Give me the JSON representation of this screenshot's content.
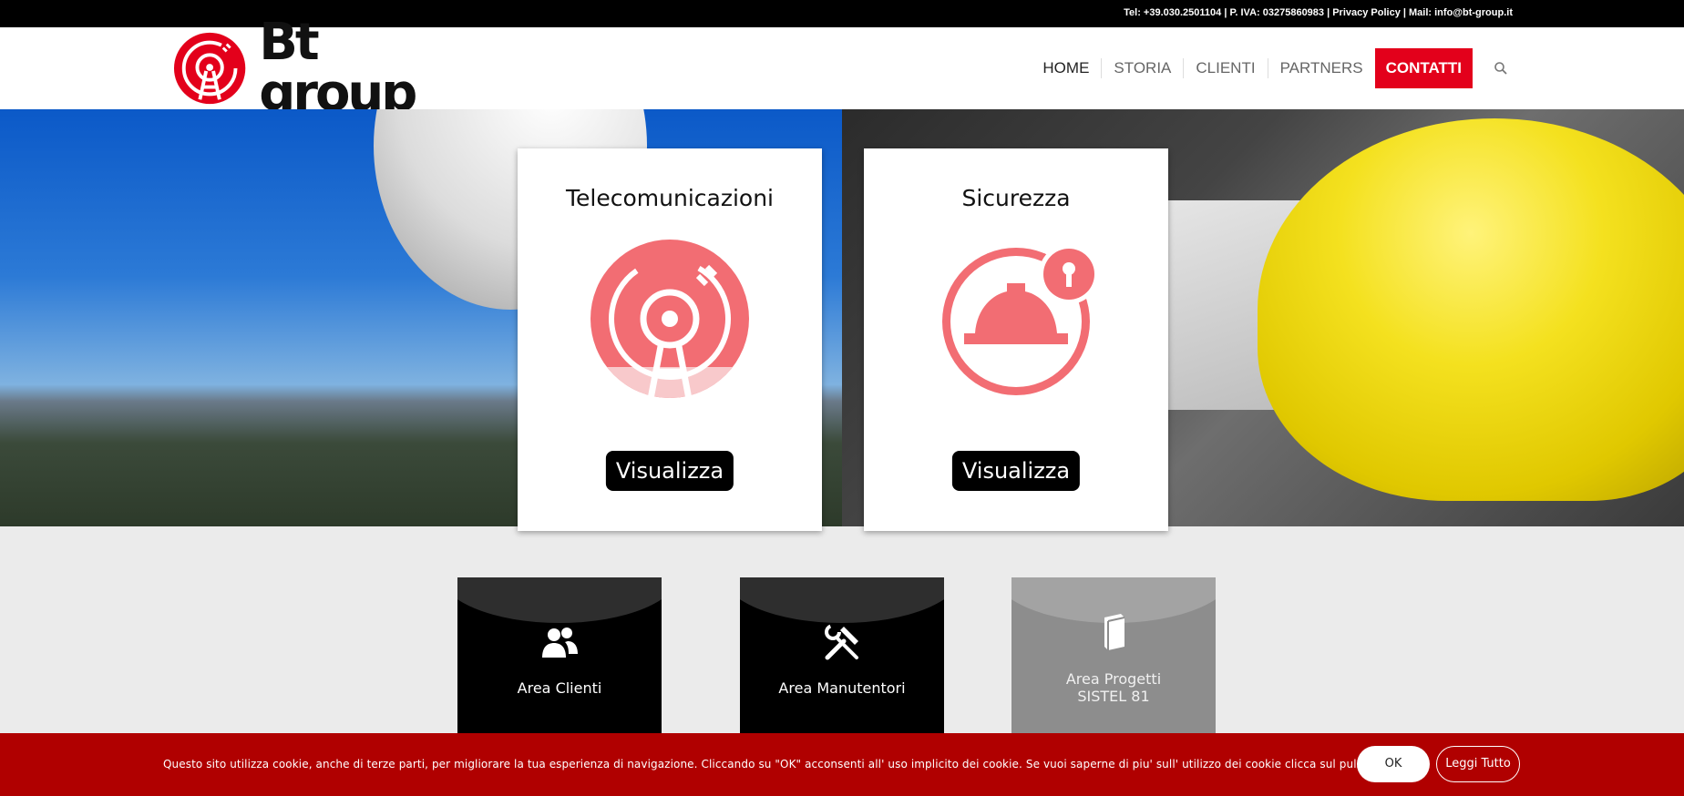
{
  "topbar": {
    "contact_info": "Tel: +39.030.2501104 | P. IVA: 03275860983 | Privacy Policy | Mail: info@bt-group.it"
  },
  "header": {
    "logo_text": "Bt group",
    "nav": {
      "home": "HOME",
      "storia": "STORIA",
      "clienti": "CLIENTI",
      "partners": "PARTNERS",
      "contatti": "CONTATTI"
    },
    "search_icon": "search-icon"
  },
  "services": [
    {
      "title": "Telecomunicazioni",
      "button": "Visualizza",
      "icon": "antenna-icon"
    },
    {
      "title": "Sicurezza",
      "button": "Visualizza",
      "icon": "helmet-icon"
    }
  ],
  "areas": [
    {
      "label": "Area Clienti",
      "icon": "users-icon"
    },
    {
      "label": "Area Manutentori",
      "icon": "tools-icon"
    },
    {
      "label_line1": "Area Progetti",
      "label_line2": "SISTEL 81",
      "icon": "book-icon"
    }
  ],
  "cookie_banner": {
    "text": "Questo sito utilizza cookie, anche di terze parti, per migliorare la tua esperienza di navigazione. Cliccando su \"OK\" acconsenti all' uso implicito dei cookie. Se vuoi saperne di piu' sull' utilizzo dei cookie clicca sul pulsante \"Info\"",
    "ok_label": "OK",
    "info_label": "Leggi Tutto"
  },
  "colors": {
    "brand_red": "#e3001b",
    "icon_pink": "#f26d73",
    "banner_red": "#b00000"
  }
}
